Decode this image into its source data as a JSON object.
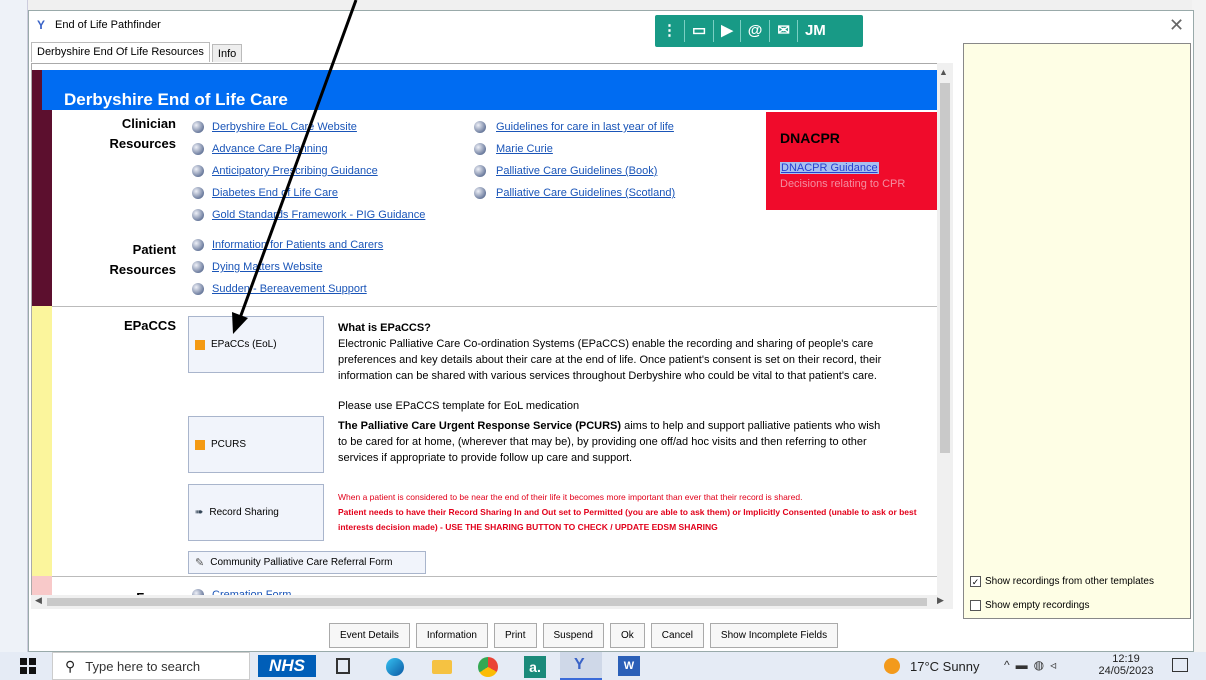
{
  "window": {
    "title": "End of Life Pathfinder"
  },
  "teams_bar": {
    "items": [
      "⋮",
      "▭",
      "▶",
      "@",
      "✉",
      "JM"
    ]
  },
  "tabs": [
    {
      "label": "Derbyshire End Of Life Resources"
    },
    {
      "label": "Info"
    }
  ],
  "header": {
    "title": "Derbyshire End of Life Care"
  },
  "clinician": {
    "heading_line1": "Clinician",
    "heading_line2": "Resources",
    "col1": [
      "Derbyshire EoL Care Website",
      "Advance Care Planning",
      "Anticipatory Prescribing Guidance",
      "Diabetes End of Life Care",
      "Gold Standards Framework - PIG Guidance"
    ],
    "col2": [
      "Guidelines for care in last year of life",
      "Marie Curie",
      "Palliative Care Guidelines (Book)",
      "Palliative Care Guidelines (Scotland)"
    ]
  },
  "dnacpr": {
    "title": "DNACPR",
    "link1": "DNACPR Guidance",
    "link2": "Decisions relating to CPR"
  },
  "patient": {
    "heading_line1": "Patient",
    "heading_line2": "Resources",
    "links": [
      "Information for Patients and Carers",
      "Dying Matters Website",
      "Sudden - Bereavement Support"
    ]
  },
  "epaccs": {
    "heading": "EPaCCS",
    "buttons": {
      "epaccs": "EPaCCs (EoL)",
      "pcurs": "PCURS",
      "record": "Record Sharing",
      "community": "Community Palliative Care Referral Form"
    },
    "what_title": "What is EPaCCS?",
    "what_text": "Electronic Palliative Care Co-ordination Systems (EPaCCS) enable the recording and sharing of people's care preferences and key details about their care at the end of life. Once patient's consent is set on their record, their information can be shared with various services throughout Derbyshire who could be vital to that patient's care.",
    "template_note": "Please use EPaCCS template for EoL medication",
    "pcurs_bold": "The Palliative Care Urgent Response Service (PCURS)",
    "pcurs_text": " aims to help and support palliative patients who wish to be cared for at home, (wherever that may be), by providing one off/ad hoc visits and then referring to other services if appropriate to provide follow up care and support.",
    "sharing_line1": "When a patient is considered to be near the end of their life it becomes more important than ever that their record is shared.",
    "sharing_line2": "Patient needs to have their Record Sharing In and Out set to Permitted (you are able to ask them)  or Implicitly Consented (unable to ask or best interests decision made) - USE THE SHARING BUTTON TO CHECK / UPDATE EDSM SHARING"
  },
  "forms": {
    "heading": "Forms",
    "links": [
      "Cremation Form"
    ]
  },
  "right_panel": {
    "show_other_templates": "Show recordings from other templates",
    "show_empty": "Show empty recordings"
  },
  "bottom_buttons": [
    "Event Details",
    "Information",
    "Print",
    "Suspend",
    "Ok",
    "Cancel",
    "Show Incomplete Fields"
  ],
  "taskbar": {
    "search_placeholder": "Type here to search",
    "nhs_logo": "NHS",
    "weather": "17°C  Sunny",
    "time": "12:19",
    "date": "24/05/2023"
  },
  "colors": {
    "header_blue": "#006cf2",
    "dnacpr_red": "#f00b2b",
    "link_blue": "#1a55b8",
    "teams_green": "#189a86",
    "clinician_bar": "#5c0f2e",
    "epaccs_bar": "#fbf59c"
  }
}
